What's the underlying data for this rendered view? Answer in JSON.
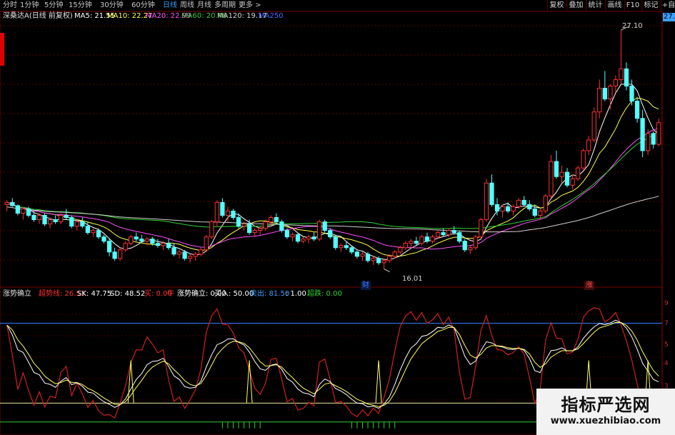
{
  "period_tabs": [
    "分时",
    "1分钟",
    "5分钟",
    "15分钟",
    "30分钟",
    "60分钟",
    "日线",
    "周线",
    "月线",
    "多周期",
    "更多 >"
  ],
  "active_tab": "日线",
  "toolbar": {
    "buttons": [
      "复权",
      "叠加",
      "统计",
      "画线",
      "F10",
      "标记",
      "+自选",
      "◀"
    ]
  },
  "stock": {
    "title": "深桑达A(日线 前复权)"
  },
  "ma_legend": [
    {
      "label": "MA5: 21.55",
      "color": "#ffffff"
    },
    {
      "label": "MA10: 22.27",
      "color": "#ffff4a"
    },
    {
      "label": "MA20: 22.99",
      "color": "#ff50ff"
    },
    {
      "label": "MA60: 20.46",
      "color": "#30d030"
    },
    {
      "label": "MA120: 19.17",
      "color": "#d0d0d0"
    },
    {
      "label": "MA250",
      "color": "#3a6bff"
    }
  ],
  "price_axis": {
    "top_label": "27.1"
  },
  "price_annotations": {
    "high": "27.10",
    "low": "16.01"
  },
  "event_markers": {
    "cai": "财",
    "zhang": "涨"
  },
  "indicator": {
    "name": "涨势确立",
    "values": [
      {
        "label": "超势线: 26.53",
        "color": "#ff3030"
      },
      {
        "label": "SK: 47.75",
        "color": "#ffffff"
      },
      {
        "label": "SD: 48.52",
        "color": "#ffffff"
      },
      {
        "label": "买: 0.00",
        "color": "#ff3030"
      },
      {
        "label": "牛",
        "color": "#ff3030"
      },
      {
        "label": "涨势确立: 0.00",
        "color": "#ffffff"
      },
      {
        "label": "买入: 50.00",
        "color": "#ffffff"
      },
      {
        "label": "卖出: 81.50",
        "color": "#3aa0ff"
      },
      {
        "label": ": 1.00",
        "color": "#ffffff"
      },
      {
        "label": "超跌: 0.00",
        "color": "#30d030"
      }
    ]
  },
  "indicator_axis": [
    "9",
    "7",
    "5",
    "4",
    "3"
  ],
  "watermark": {
    "title": "指标严选网",
    "url": "www.xuezhibiao.com"
  },
  "chart_data": {
    "type": "candlestick",
    "price_range": [
      15.5,
      27.5
    ],
    "candles": [
      [
        19.0,
        19.2,
        18.7,
        19.1
      ],
      [
        19.1,
        19.3,
        18.9,
        18.95
      ],
      [
        18.95,
        19.0,
        18.5,
        18.6
      ],
      [
        18.6,
        18.9,
        18.3,
        18.8
      ],
      [
        18.8,
        18.9,
        18.4,
        18.5
      ],
      [
        18.5,
        18.7,
        18.2,
        18.3
      ],
      [
        18.3,
        18.6,
        18.1,
        18.5
      ],
      [
        18.5,
        18.6,
        18.0,
        18.1
      ],
      [
        18.1,
        18.4,
        17.9,
        18.3
      ],
      [
        18.3,
        18.5,
        18.1,
        18.2
      ],
      [
        18.2,
        18.6,
        18.1,
        18.5
      ],
      [
        18.5,
        18.8,
        18.3,
        18.4
      ],
      [
        18.4,
        18.5,
        17.9,
        18.0
      ],
      [
        18.0,
        18.3,
        17.8,
        18.2
      ],
      [
        18.2,
        18.4,
        17.9,
        18.0
      ],
      [
        18.0,
        18.2,
        17.6,
        17.7
      ],
      [
        17.7,
        17.9,
        17.5,
        17.8
      ],
      [
        17.8,
        17.9,
        17.4,
        17.5
      ],
      [
        17.5,
        17.6,
        17.2,
        17.3
      ],
      [
        17.3,
        17.4,
        16.6,
        16.8
      ],
      [
        16.8,
        17.0,
        16.4,
        16.5
      ],
      [
        16.5,
        17.0,
        16.4,
        16.9
      ],
      [
        16.9,
        17.3,
        16.8,
        17.2
      ],
      [
        17.2,
        17.6,
        17.1,
        17.5
      ],
      [
        17.5,
        17.7,
        17.3,
        17.4
      ],
      [
        17.4,
        17.6,
        17.2,
        17.3
      ],
      [
        17.3,
        17.5,
        17.1,
        17.4
      ],
      [
        17.4,
        17.5,
        17.1,
        17.2
      ],
      [
        17.2,
        17.4,
        17.0,
        17.1
      ],
      [
        17.1,
        17.3,
        16.9,
        17.2
      ],
      [
        17.2,
        17.4,
        16.9,
        17.0
      ],
      [
        17.0,
        17.2,
        16.6,
        16.7
      ],
      [
        16.7,
        16.9,
        16.5,
        16.8
      ],
      [
        16.8,
        16.9,
        16.4,
        16.5
      ],
      [
        16.5,
        16.7,
        16.3,
        16.6
      ],
      [
        16.6,
        16.8,
        16.4,
        16.7
      ],
      [
        16.7,
        17.0,
        16.6,
        16.9
      ],
      [
        16.9,
        17.6,
        16.8,
        17.5
      ],
      [
        17.5,
        18.3,
        17.4,
        18.2
      ],
      [
        18.2,
        19.2,
        18.0,
        19.1
      ],
      [
        19.1,
        19.3,
        18.4,
        18.5
      ],
      [
        18.5,
        18.9,
        18.2,
        18.7
      ],
      [
        18.7,
        18.8,
        18.3,
        18.4
      ],
      [
        18.4,
        18.6,
        17.9,
        18.0
      ],
      [
        18.0,
        18.2,
        17.8,
        18.1
      ],
      [
        18.1,
        18.3,
        17.6,
        17.7
      ],
      [
        17.7,
        17.9,
        17.5,
        17.8
      ],
      [
        17.8,
        18.0,
        17.6,
        17.9
      ],
      [
        17.9,
        18.3,
        17.8,
        18.2
      ],
      [
        18.2,
        18.5,
        18.0,
        18.4
      ],
      [
        18.4,
        18.6,
        18.1,
        18.2
      ],
      [
        18.2,
        18.3,
        17.7,
        17.8
      ],
      [
        17.8,
        17.9,
        17.4,
        17.5
      ],
      [
        17.5,
        17.7,
        17.3,
        17.6
      ],
      [
        17.6,
        17.7,
        17.2,
        17.3
      ],
      [
        17.3,
        17.5,
        17.2,
        17.4
      ],
      [
        17.4,
        17.6,
        17.2,
        17.5
      ],
      [
        17.5,
        17.7,
        17.3,
        17.4
      ],
      [
        17.4,
        18.3,
        17.3,
        18.2
      ],
      [
        18.2,
        18.3,
        17.7,
        17.8
      ],
      [
        17.8,
        17.9,
        17.4,
        17.5
      ],
      [
        17.5,
        17.6,
        16.9,
        17.0
      ],
      [
        17.0,
        17.2,
        16.8,
        17.1
      ],
      [
        17.1,
        17.3,
        16.9,
        17.0
      ],
      [
        17.0,
        17.1,
        16.7,
        16.8
      ],
      [
        16.8,
        16.9,
        16.5,
        16.6
      ],
      [
        16.6,
        16.8,
        16.4,
        16.7
      ],
      [
        16.7,
        16.8,
        16.3,
        16.4
      ],
      [
        16.4,
        16.6,
        16.2,
        16.5
      ],
      [
        16.5,
        16.6,
        16.2,
        16.3
      ],
      [
        16.3,
        16.5,
        16.01,
        16.4
      ],
      [
        16.4,
        16.7,
        16.3,
        16.6
      ],
      [
        16.6,
        16.9,
        16.5,
        16.8
      ],
      [
        16.8,
        17.1,
        16.7,
        17.0
      ],
      [
        17.0,
        17.3,
        16.9,
        17.2
      ],
      [
        17.2,
        17.4,
        17.0,
        17.3
      ],
      [
        17.3,
        17.5,
        17.1,
        17.2
      ],
      [
        17.2,
        17.6,
        17.1,
        17.5
      ],
      [
        17.5,
        17.7,
        17.2,
        17.3
      ],
      [
        17.3,
        17.6,
        17.2,
        17.5
      ],
      [
        17.5,
        17.8,
        17.4,
        17.7
      ],
      [
        17.7,
        17.9,
        17.5,
        17.6
      ],
      [
        17.6,
        17.9,
        17.5,
        17.8
      ],
      [
        17.8,
        18.0,
        17.6,
        17.7
      ],
      [
        17.7,
        17.8,
        17.2,
        17.3
      ],
      [
        17.3,
        17.4,
        16.8,
        16.9
      ],
      [
        16.9,
        17.1,
        16.7,
        17.0
      ],
      [
        17.0,
        17.6,
        16.9,
        17.5
      ],
      [
        17.5,
        18.4,
        17.4,
        18.3
      ],
      [
        18.3,
        20.2,
        18.2,
        20.0
      ],
      [
        20.0,
        20.4,
        18.9,
        19.0
      ],
      [
        19.0,
        19.3,
        18.5,
        18.7
      ],
      [
        18.7,
        19.0,
        18.4,
        18.9
      ],
      [
        18.9,
        19.1,
        18.6,
        18.7
      ],
      [
        18.7,
        19.0,
        18.5,
        18.9
      ],
      [
        18.9,
        19.3,
        18.8,
        19.2
      ],
      [
        19.2,
        19.4,
        18.9,
        19.0
      ],
      [
        19.0,
        19.2,
        18.7,
        18.8
      ],
      [
        18.8,
        19.0,
        18.4,
        18.5
      ],
      [
        18.5,
        18.8,
        18.3,
        18.7
      ],
      [
        18.7,
        19.5,
        18.6,
        19.4
      ],
      [
        19.4,
        21.3,
        19.3,
        21.0
      ],
      [
        21.0,
        21.5,
        20.2,
        20.3
      ],
      [
        20.3,
        20.8,
        20.0,
        20.5
      ],
      [
        20.5,
        20.7,
        19.8,
        19.9
      ],
      [
        19.9,
        20.4,
        19.7,
        20.2
      ],
      [
        20.2,
        20.8,
        20.1,
        20.7
      ],
      [
        20.7,
        21.6,
        20.6,
        21.5
      ],
      [
        21.5,
        22.2,
        21.3,
        22.0
      ],
      [
        22.0,
        23.5,
        21.9,
        23.3
      ],
      [
        23.3,
        24.8,
        23.0,
        24.4
      ],
      [
        24.4,
        25.2,
        23.8,
        23.9
      ],
      [
        23.9,
        24.6,
        23.4,
        24.5
      ],
      [
        24.5,
        25.0,
        24.2,
        24.8
      ],
      [
        24.8,
        27.1,
        24.6,
        25.3
      ],
      [
        25.3,
        25.6,
        24.3,
        24.5
      ],
      [
        24.5,
        24.8,
        23.6,
        23.8
      ],
      [
        23.8,
        24.0,
        22.8,
        23.0
      ],
      [
        23.0,
        23.4,
        21.2,
        21.5
      ],
      [
        21.5,
        22.5,
        21.3,
        22.3
      ],
      [
        22.3,
        22.4,
        21.6,
        21.8
      ],
      [
        21.8,
        23.0,
        21.7,
        22.8
      ]
    ],
    "indicator_range": [
      0,
      100
    ],
    "buy_level": 50,
    "sell_level": 81.5,
    "buy_signal_bars": [
      23,
      45,
      69,
      108,
      119
    ]
  }
}
